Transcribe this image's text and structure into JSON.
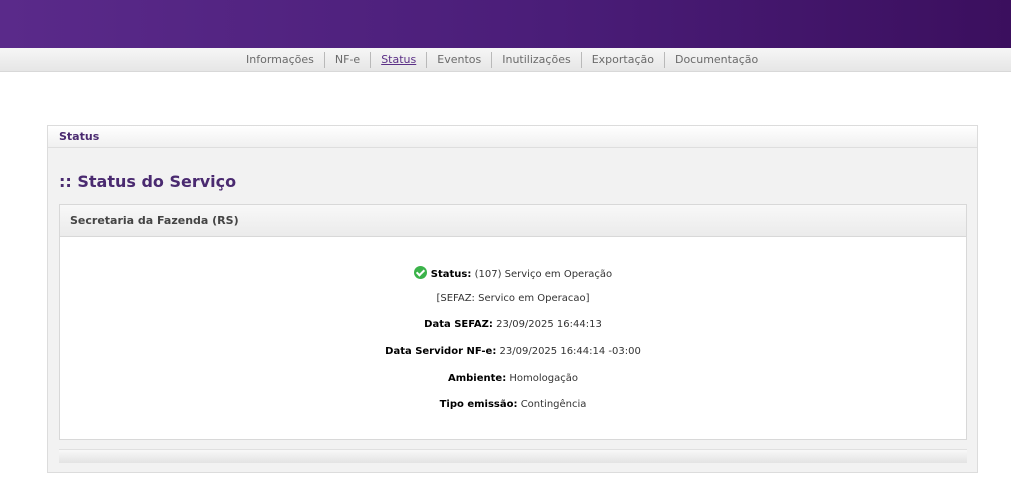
{
  "nav": {
    "items": [
      "Informações",
      "NF-e",
      "Status",
      "Eventos",
      "Inutilizações",
      "Exportação",
      "Documentação"
    ],
    "active": "Status"
  },
  "panel": {
    "header": "Status",
    "title": ":: Status do Serviço",
    "inner_header": "Secretaria da Fazenda (RS)"
  },
  "status": {
    "status_label": "Status:",
    "status_value": "(107) Serviço em Operação",
    "sefaz_message": "[SEFAZ: Servico em Operacao]",
    "data_sefaz_label": "Data SEFAZ:",
    "data_sefaz_value": "23/09/2025 16:44:13",
    "data_servidor_label": "Data Servidor NF-e:",
    "data_servidor_value": "23/09/2025 16:44:14 -03:00",
    "ambiente_label": "Ambiente:",
    "ambiente_value": "Homologação",
    "tipo_emissao_label": "Tipo emissão:",
    "tipo_emissao_value": "Contingência"
  },
  "colors": {
    "brand": "#4a1d78",
    "ok": "#3bb34a"
  }
}
